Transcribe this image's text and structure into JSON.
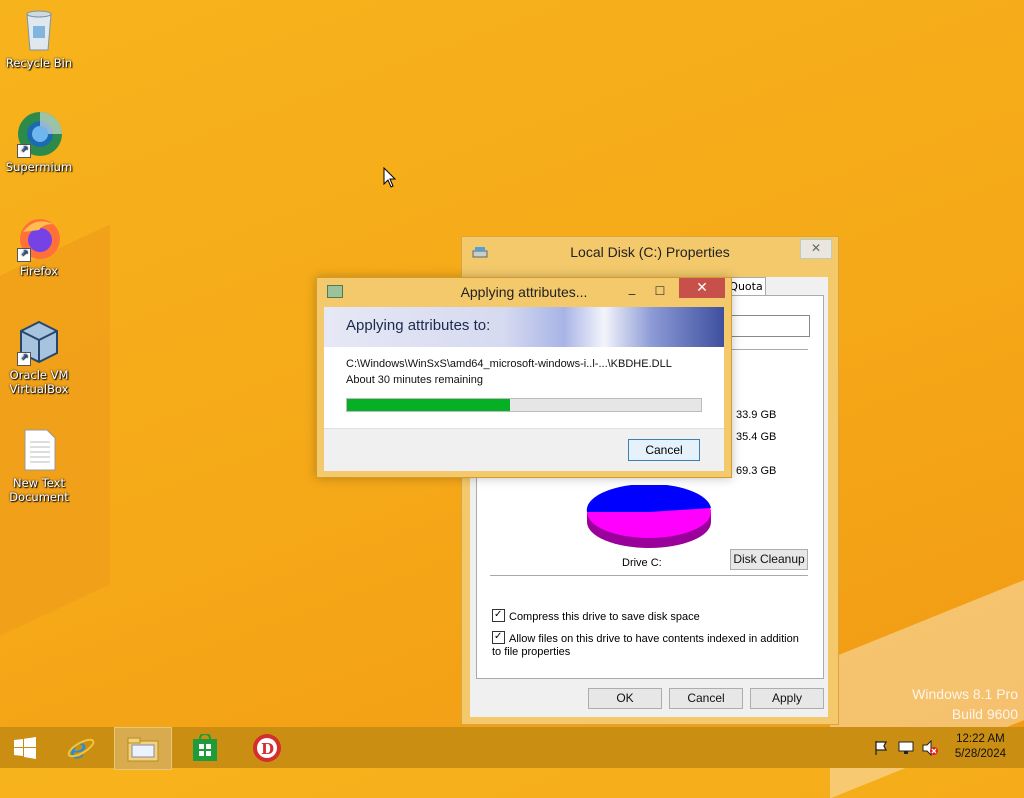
{
  "desktop": {
    "icons": [
      {
        "label": "Recycle Bin",
        "icon": "recycle-bin-icon"
      },
      {
        "label": "Supermium",
        "icon": "supermium-icon"
      },
      {
        "label": "Firefox",
        "icon": "firefox-icon"
      },
      {
        "label": "Oracle VM VirtualBox",
        "icon": "virtualbox-icon"
      },
      {
        "label": "New Text Document",
        "icon": "text-document-icon"
      }
    ],
    "watermark": {
      "line1": "Windows 8.1 Pro",
      "line2": "Build 9600"
    }
  },
  "properties": {
    "title": "Local Disk (C:) Properties",
    "tab_label": "Quota",
    "used": "33.9 GB",
    "free": "35.4 GB",
    "capacity": "69.3 GB",
    "used_color": "#ff00ff",
    "free_color": "#0000ff",
    "drive_label": "Drive C:",
    "disk_cleanup_label": "Disk Cleanup",
    "compress_label": "Compress this drive to save disk space",
    "compress_checked": true,
    "index_label": "Allow files on this drive to have contents indexed in addition to file properties",
    "index_checked": true,
    "ok_label": "OK",
    "cancel_label": "Cancel",
    "apply_label": "Apply"
  },
  "progress_dialog": {
    "title": "Applying attributes...",
    "heading": "Applying attributes to:",
    "path": "C:\\Windows\\WinSxS\\amd64_microsoft-windows-i..l-...\\KBDHE.DLL",
    "time_remaining": "About 30 minutes remaining",
    "progress_fraction": 0.46,
    "progress_color": "#06b025",
    "cancel_label": "Cancel"
  },
  "taskbar": {
    "items": [
      "start-button",
      "internet-explorer",
      "file-explorer",
      "store",
      "app-d"
    ],
    "clock_time": "12:22 AM",
    "clock_date": "5/28/2024"
  }
}
